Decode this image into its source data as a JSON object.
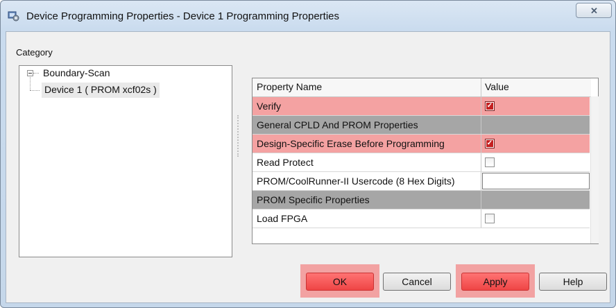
{
  "window": {
    "title": "Device Programming Properties - Device 1 Programming Properties",
    "close_glyph": "✕"
  },
  "category": {
    "label": "Category",
    "tree": {
      "root": "Boundary-Scan",
      "child": "Device 1 ( PROM xcf02s )"
    }
  },
  "grid": {
    "headers": {
      "name": "Property Name",
      "value": "Value"
    },
    "rows": [
      {
        "name": "Verify",
        "type": "checkbox",
        "checked": true,
        "highlight": "red"
      },
      {
        "name": "General CPLD And PROM Properties",
        "type": "group"
      },
      {
        "name": "Design-Specific Erase Before Programming",
        "type": "checkbox",
        "checked": true,
        "highlight": "red"
      },
      {
        "name": "Read Protect",
        "type": "checkbox",
        "checked": false
      },
      {
        "name": "PROM/CoolRunner-II Usercode (8 Hex Digits)",
        "type": "text",
        "value": ""
      },
      {
        "name": "PROM Specific Properties",
        "type": "group"
      },
      {
        "name": "Load FPGA",
        "type": "checkbox",
        "checked": false
      }
    ]
  },
  "buttons": {
    "ok": "OK",
    "cancel": "Cancel",
    "apply": "Apply",
    "help": "Help"
  },
  "colors": {
    "highlight_row": "#f4a2a2",
    "group_row": "#a6a6a6",
    "button_highlight": "#ef4545",
    "check_mark": "#c42020"
  },
  "icons": {
    "app": "device-properties-icon",
    "close": "close-icon",
    "expander": "collapse-tree-icon"
  }
}
